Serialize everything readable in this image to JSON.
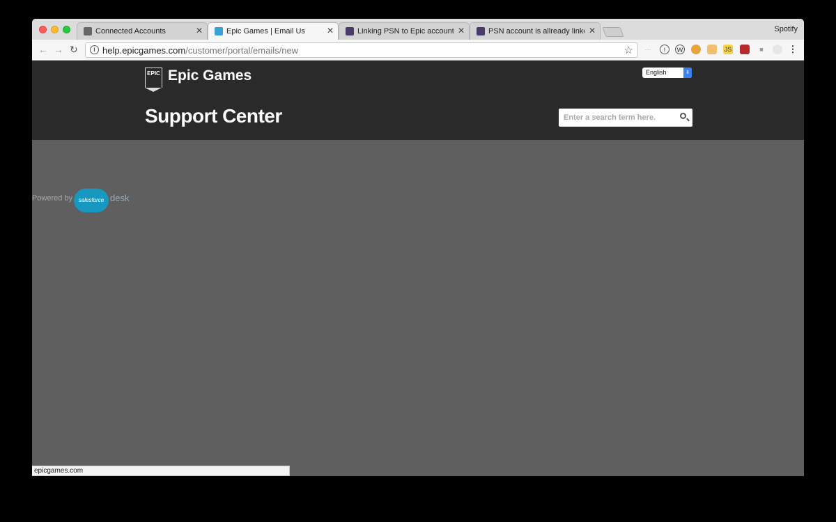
{
  "tabs": [
    {
      "title": "Connected Accounts",
      "favicon": "epic-icon",
      "active": false
    },
    {
      "title": "Epic Games | Email Us",
      "favicon": "desk-icon",
      "active": true
    },
    {
      "title": "Linking PSN to Epic account pr",
      "favicon": "forum-icon",
      "active": false
    },
    {
      "title": "PSN account is allready linked",
      "favicon": "forum-icon",
      "active": false
    }
  ],
  "profile_name": "Spotify",
  "omnibox": {
    "host": "help.epicgames.com",
    "path": "/customer/portal/emails/new"
  },
  "header": {
    "brand_logo_text": "EPIC",
    "brand": "Epic Games",
    "language": "English",
    "title": "Support Center",
    "search_placeholder": "Enter a search term here."
  },
  "powered": {
    "prefix": "Powered by",
    "cloud": "salesforce",
    "suffix": "desk"
  },
  "statusbar": "epicgames.com",
  "colors": {
    "header_bg": "#2a2a2a",
    "content_bg": "#5f5f5f",
    "salesforce_blue": "#1798c1"
  }
}
